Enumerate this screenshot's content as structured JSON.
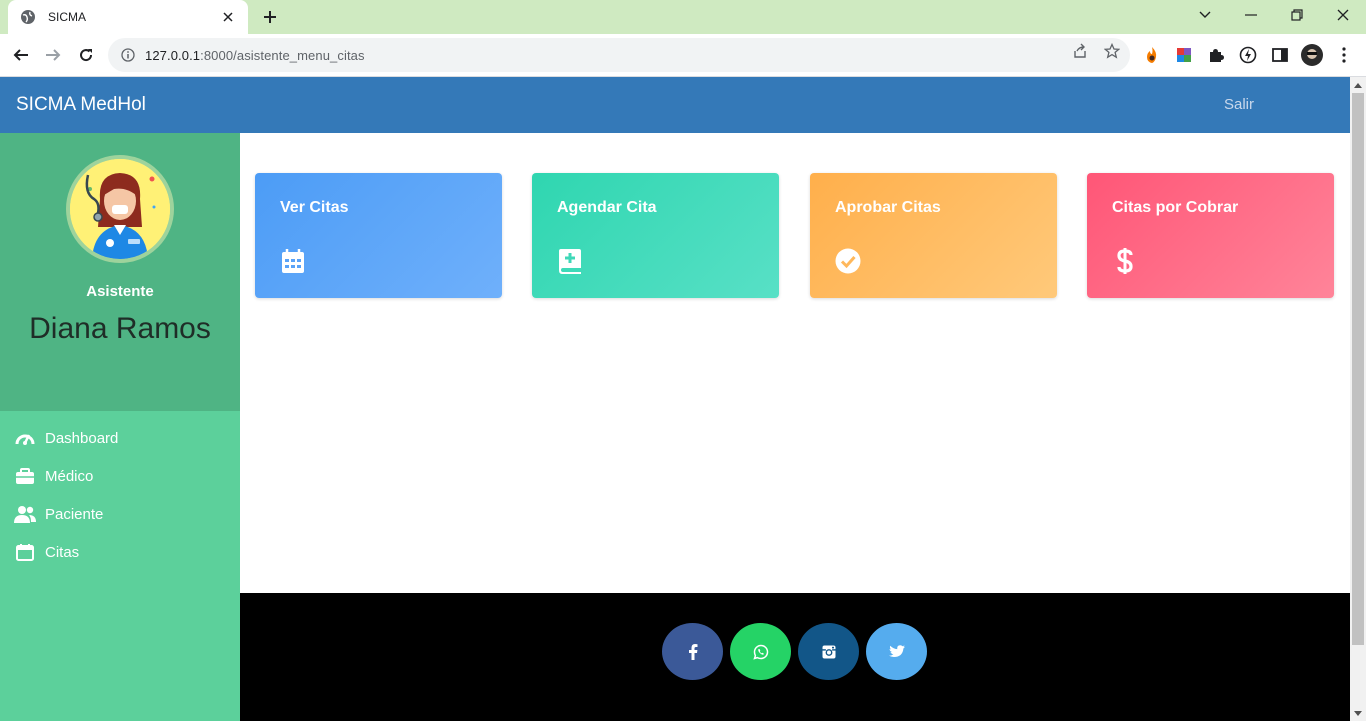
{
  "browser": {
    "tab_title": "SICMA",
    "url_host": "127.0.0.1",
    "url_port_path": ":8000/asistente_menu_citas"
  },
  "app": {
    "brand": "SICMA MedHol",
    "logout_label": "Salir",
    "colors": {
      "navbar": "#3479b8",
      "sidebar": "#5cd09b",
      "profile_bg": "#4fb484"
    }
  },
  "profile": {
    "role": "Asistente",
    "name": "Diana Ramos"
  },
  "sidebar": {
    "items": [
      {
        "label": "Dashboard",
        "icon": "tachometer-icon"
      },
      {
        "label": "Médico",
        "icon": "briefcase-medical-icon"
      },
      {
        "label": "Paciente",
        "icon": "users-icon"
      },
      {
        "label": "Citas",
        "icon": "calendar-icon"
      }
    ]
  },
  "cards": [
    {
      "title": "Ver Citas",
      "icon": "calendar-icon",
      "color": "#4c9cf6"
    },
    {
      "title": "Agendar Cita",
      "icon": "book-medical-icon",
      "color": "#2fd6b0"
    },
    {
      "title": "Aprobar Citas",
      "icon": "check-circle-icon",
      "color": "#ffaf4b"
    },
    {
      "title": "Citas por Cobrar",
      "icon": "dollar-icon",
      "color": "#ff5677"
    }
  ],
  "footer": {
    "social": [
      {
        "name": "facebook-icon",
        "color": "#3b5998"
      },
      {
        "name": "whatsapp-icon",
        "color": "#25d366"
      },
      {
        "name": "instagram-icon",
        "color": "#125688"
      },
      {
        "name": "twitter-icon",
        "color": "#55acee"
      }
    ]
  }
}
